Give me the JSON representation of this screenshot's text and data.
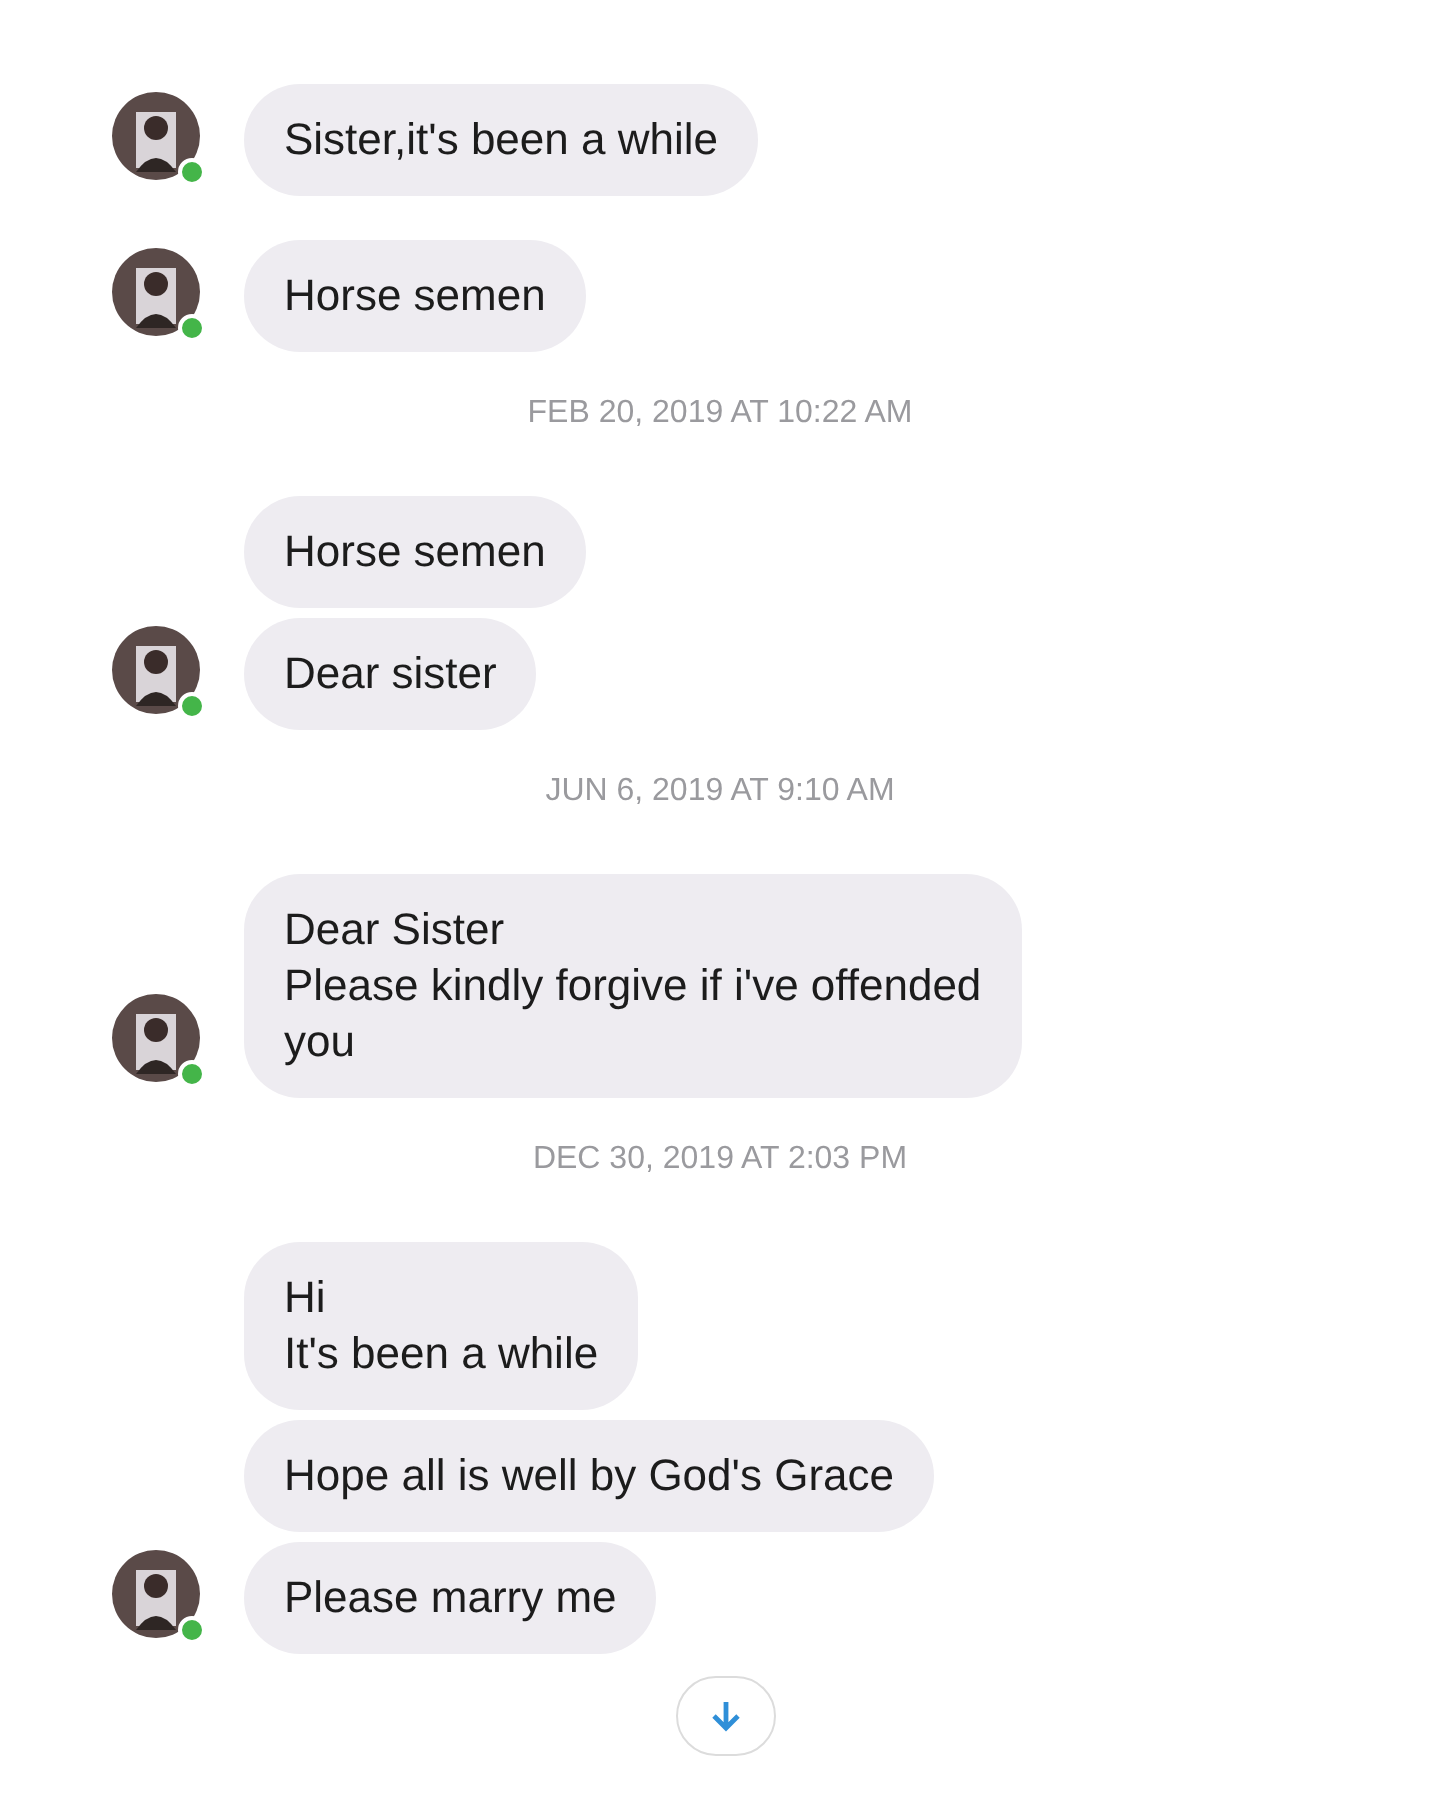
{
  "conversation": [
    {
      "kind": "group",
      "messages": [
        "Sister,it's been a while"
      ]
    },
    {
      "kind": "group",
      "messages": [
        "Horse semen"
      ]
    },
    {
      "kind": "timestamp",
      "text": "FEB 20, 2019 AT 10:22 AM"
    },
    {
      "kind": "group",
      "messages": [
        "Horse semen",
        "Dear sister"
      ]
    },
    {
      "kind": "timestamp",
      "text": "JUN 6, 2019 AT 9:10 AM"
    },
    {
      "kind": "group",
      "messages": [
        "Dear Sister\nPlease kindly forgive if i've offended\nyou"
      ]
    },
    {
      "kind": "timestamp",
      "text": "DEC 30, 2019 AT 2:03 PM"
    },
    {
      "kind": "group",
      "messages": [
        "Hi\nIt's been a while",
        "Hope all is well by God's Grace",
        "Please marry me"
      ]
    }
  ]
}
